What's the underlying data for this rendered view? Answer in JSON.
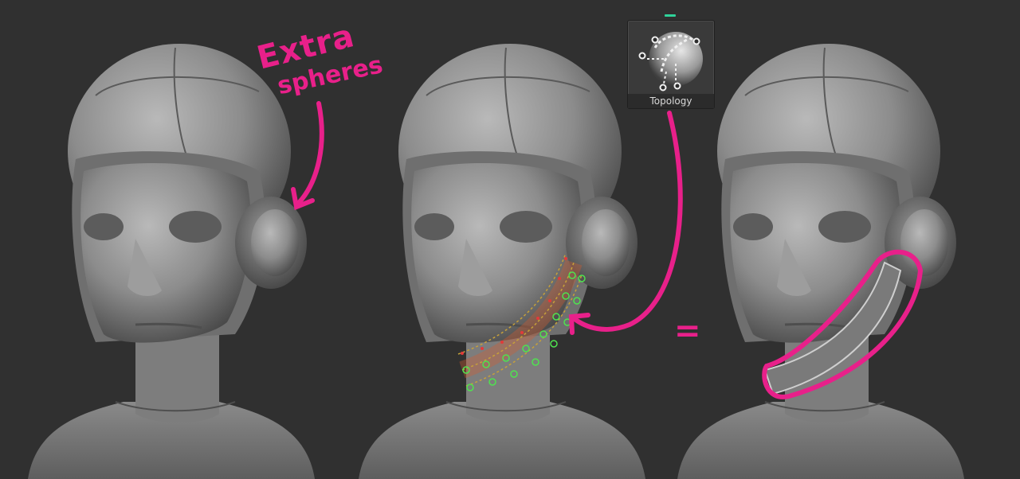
{
  "annotations": {
    "extra_line1": "Extra",
    "extra_line2": "spheres",
    "equals": "="
  },
  "brush": {
    "label": "Topology",
    "icon": "topology-brush-icon"
  },
  "colors": {
    "background": "#303030",
    "annotation": "#e8208a",
    "active_marker": "#2fd39a",
    "clay": "#8e8e8e",
    "topo_points_green": "#4fe24f",
    "topo_points_red": "#e23a3a"
  }
}
